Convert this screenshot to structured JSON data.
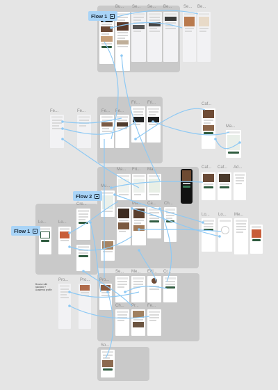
{
  "flows": [
    {
      "label": "Flow 1",
      "icon": "flow-start-icon"
    },
    {
      "label": "Flow 2",
      "icon": "flow-start-icon"
    },
    {
      "label": "Flow 1",
      "icon": "flow-start-icon"
    }
  ],
  "frame_labels": [
    "Bu...",
    "Se...",
    "Se...",
    "Be...",
    "Se...",
    "Be...",
    "Fe...",
    "Fe...",
    "Fe...",
    "Fe...",
    "Fri...",
    "Fri...",
    "Caf...",
    "Ma...",
    "Mu...",
    "Ma...",
    "Fri...",
    "Ma...",
    "Caf...",
    "Caf...",
    "Ad...",
    "Cre...",
    "Lo...",
    "Lo...",
    "Ma...",
    "Ca...",
    "Ch...",
    "Lo...",
    "Lo...",
    "Me...",
    "Pro...",
    "Pro...",
    "Pro...",
    "Se...",
    "Me...",
    "Edi...",
    "Cr...",
    "Ch...",
    "Pr...",
    "Fe...",
    "So..."
  ],
  "note": "Browse with standard + Academic profile",
  "accent_colors": {
    "flow_tag": "#a9d4f7",
    "wire": "#8ec9f4",
    "brand_green": "#2f5b3f",
    "section": "#c9c9c9"
  }
}
